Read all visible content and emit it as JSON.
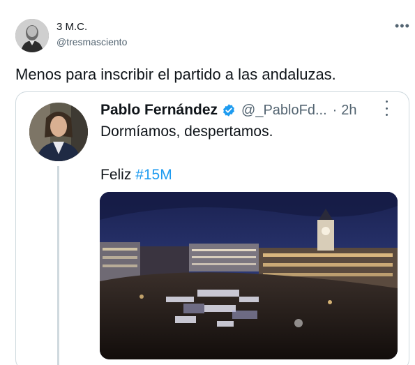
{
  "tweet": {
    "author": {
      "display_name": "3 M.C.",
      "handle": "@tresmasciento"
    },
    "more_icon_label": "•••",
    "text": "Menos para inscribir el partido a las andaluzas."
  },
  "quoted_tweet": {
    "author": {
      "display_name": "Pablo Fernández",
      "handle": "@_PabloFd...",
      "verified": true
    },
    "separator": "·",
    "time": "2h",
    "line1": "Dormíamos, despertamos.",
    "line2_prefix": "Feliz ",
    "hashtag": "#15M",
    "media": {
      "kind": "photo",
      "subject": "night-crowd-square-photo"
    }
  },
  "colors": {
    "text": "#0f1419",
    "secondary": "#536471",
    "link": "#1d9bf0",
    "border": "#cfd9de",
    "verified": "#1d9bf0"
  }
}
